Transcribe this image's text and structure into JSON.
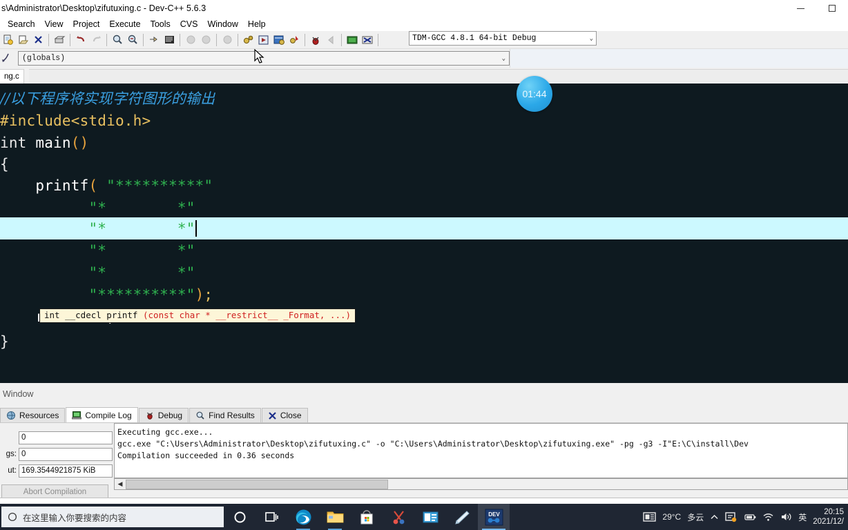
{
  "window": {
    "title": "s\\Administrator\\Desktop\\zifutuxing.c - Dev-C++ 5.6.3",
    "minimize_label": "Minimize",
    "maximize_label": "Maximize"
  },
  "menubar": {
    "items": [
      {
        "label": "Search",
        "name": "menu-search"
      },
      {
        "label": "View",
        "name": "menu-view"
      },
      {
        "label": "Project",
        "name": "menu-project"
      },
      {
        "label": "Execute",
        "name": "menu-execute"
      },
      {
        "label": "Tools",
        "name": "menu-tools"
      },
      {
        "label": "CVS",
        "name": "menu-cvs"
      },
      {
        "label": "Window",
        "name": "menu-window"
      },
      {
        "label": "Help",
        "name": "menu-help"
      }
    ]
  },
  "toolbar": {
    "compiler_set": "TDM-GCC 4.8.1 64-bit Debug",
    "dropdown_arrow": "⌄"
  },
  "classbrowser": {
    "scope": "(globals)",
    "dropdown_arrow": "⌄"
  },
  "tabstrip": {
    "file_tab": "ng.c"
  },
  "editor": {
    "theme_bg": "#0e1a20",
    "current_line_bg": "#ccf9ff",
    "lines": [
      {
        "text": "//以下程序将实现字符图形的输出",
        "kind": "comment"
      },
      {
        "text": "#include<stdio.h>",
        "kind": "preprocessor"
      },
      {
        "text": "int main()",
        "kind": "code"
      },
      {
        "text": "{",
        "kind": "code"
      },
      {
        "text": "    printf( \"**********\"",
        "kind": "code"
      },
      {
        "text": "            \"*        *\"",
        "kind": "string"
      },
      {
        "text": "            \"*        *\"",
        "kind": "string-current"
      },
      {
        "text": "            \"*        *\"",
        "kind": "string"
      },
      {
        "text": "            \"*        *\"",
        "kind": "string"
      },
      {
        "text": "            \"**********\");",
        "kind": "string"
      },
      {
        "text": "    return 0;",
        "kind": "code"
      },
      {
        "text": "}",
        "kind": "code"
      }
    ],
    "strings": {
      "top_border": "\"**********\"",
      "side_row": "\"*        *\"",
      "bottom_border": "\"**********\""
    },
    "tooltip": {
      "prefix": "int __cdecl printf ",
      "params": "(const char * __restrict__ _Format, ...)"
    }
  },
  "timer_badge": {
    "value": "01:44",
    "color": "#2ba8e8"
  },
  "bottom_panel": {
    "header_label": "Window",
    "tabs": [
      {
        "label": "Resources",
        "name": "panel-tab-resources",
        "active": false
      },
      {
        "label": "Compile Log",
        "name": "panel-tab-compile-log",
        "active": true
      },
      {
        "label": "Debug",
        "name": "panel-tab-debug",
        "active": false
      },
      {
        "label": "Find Results",
        "name": "panel-tab-find-results",
        "active": false
      },
      {
        "label": "Close",
        "name": "panel-tab-close",
        "active": false
      }
    ],
    "fields": [
      {
        "label": "",
        "value": "0",
        "name": "errors-field"
      },
      {
        "label": "gs:",
        "value": "0",
        "name": "warnings-field"
      },
      {
        "label": "ut:",
        "value": "169.3544921875 KiB",
        "name": "output-size-field"
      }
    ],
    "abort_button": "Abort Compilation",
    "log_lines": [
      "Executing gcc.exe...",
      "gcc.exe \"C:\\Users\\Administrator\\Desktop\\zifutuxing.c\" -o \"C:\\Users\\Administrator\\Desktop\\zifutuxing.exe\" -pg -g3 -I\"E:\\C\\install\\Dev",
      "Compilation succeeded in 0.36 seconds"
    ]
  },
  "taskbar": {
    "search_placeholder": "在这里输入你要搜索的内容",
    "icons": [
      {
        "name": "cortana-icon",
        "label": "Cortana"
      },
      {
        "name": "task-view-icon",
        "label": "Task View"
      },
      {
        "name": "edge-icon",
        "label": "Microsoft Edge"
      },
      {
        "name": "file-explorer-icon",
        "label": "File Explorer"
      },
      {
        "name": "microsoft-store-icon",
        "label": "Microsoft Store"
      },
      {
        "name": "snipping-tool-icon",
        "label": "Snipping Tool"
      },
      {
        "name": "media-app-icon",
        "label": "Media"
      },
      {
        "name": "sticky-notes-icon",
        "label": "Notes"
      },
      {
        "name": "dev-cpp-icon",
        "label": "DEV"
      }
    ],
    "tray": {
      "weather_temp": "29°C",
      "weather_desc": "多云",
      "ime": "英",
      "time": "20:15",
      "date": "2021/12/"
    }
  }
}
